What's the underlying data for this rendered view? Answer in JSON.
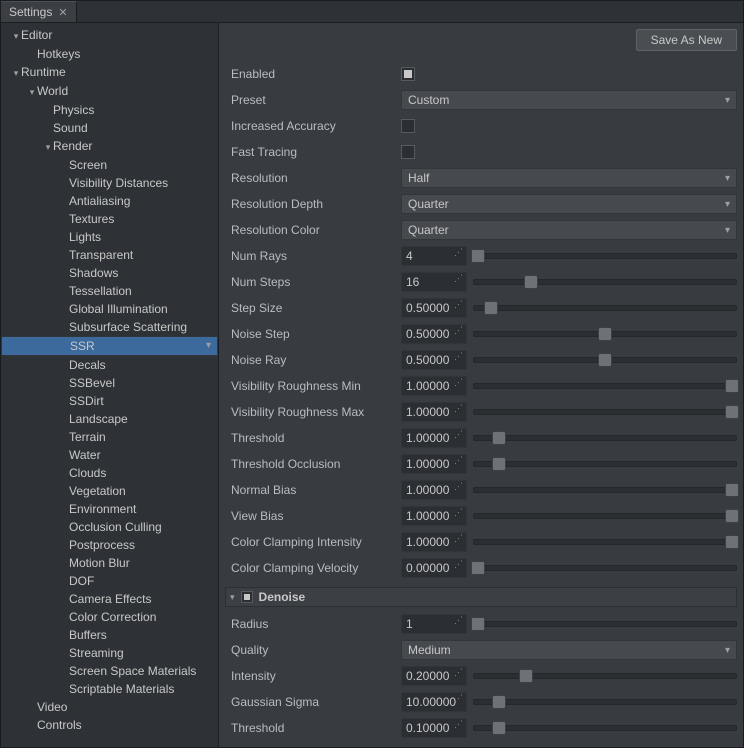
{
  "tab": {
    "title": "Settings"
  },
  "toolbar": {
    "save_as_new": "Save As New"
  },
  "tree": {
    "items": [
      {
        "label": "Editor",
        "level": 0,
        "expand": "down"
      },
      {
        "label": "Hotkeys",
        "level": 1,
        "expand": ""
      },
      {
        "label": "Runtime",
        "level": 0,
        "expand": "down"
      },
      {
        "label": "World",
        "level": 1,
        "expand": "down"
      },
      {
        "label": "Physics",
        "level": 2,
        "expand": ""
      },
      {
        "label": "Sound",
        "level": 2,
        "expand": ""
      },
      {
        "label": "Render",
        "level": 2,
        "expand": "down"
      },
      {
        "label": "Screen",
        "level": 3,
        "expand": ""
      },
      {
        "label": "Visibility Distances",
        "level": 3,
        "expand": ""
      },
      {
        "label": "Antialiasing",
        "level": 3,
        "expand": ""
      },
      {
        "label": "Textures",
        "level": 3,
        "expand": ""
      },
      {
        "label": "Lights",
        "level": 3,
        "expand": ""
      },
      {
        "label": "Transparent",
        "level": 3,
        "expand": ""
      },
      {
        "label": "Shadows",
        "level": 3,
        "expand": ""
      },
      {
        "label": "Tessellation",
        "level": 3,
        "expand": ""
      },
      {
        "label": "Global Illumination",
        "level": 3,
        "expand": ""
      },
      {
        "label": "Subsurface Scattering",
        "level": 3,
        "expand": ""
      },
      {
        "label": "SSR",
        "level": 3,
        "expand": "",
        "selected": true
      },
      {
        "label": "Decals",
        "level": 3,
        "expand": ""
      },
      {
        "label": "SSBevel",
        "level": 3,
        "expand": ""
      },
      {
        "label": "SSDirt",
        "level": 3,
        "expand": ""
      },
      {
        "label": "Landscape",
        "level": 3,
        "expand": ""
      },
      {
        "label": "Terrain",
        "level": 3,
        "expand": ""
      },
      {
        "label": "Water",
        "level": 3,
        "expand": ""
      },
      {
        "label": "Clouds",
        "level": 3,
        "expand": ""
      },
      {
        "label": "Vegetation",
        "level": 3,
        "expand": ""
      },
      {
        "label": "Environment",
        "level": 3,
        "expand": ""
      },
      {
        "label": "Occlusion Culling",
        "level": 3,
        "expand": ""
      },
      {
        "label": "Postprocess",
        "level": 3,
        "expand": ""
      },
      {
        "label": "Motion Blur",
        "level": 3,
        "expand": ""
      },
      {
        "label": "DOF",
        "level": 3,
        "expand": ""
      },
      {
        "label": "Camera Effects",
        "level": 3,
        "expand": ""
      },
      {
        "label": "Color Correction",
        "level": 3,
        "expand": ""
      },
      {
        "label": "Buffers",
        "level": 3,
        "expand": ""
      },
      {
        "label": "Streaming",
        "level": 3,
        "expand": ""
      },
      {
        "label": "Screen Space Materials",
        "level": 3,
        "expand": ""
      },
      {
        "label": "Scriptable Materials",
        "level": 3,
        "expand": ""
      },
      {
        "label": "Video",
        "level": 1,
        "expand": ""
      },
      {
        "label": "Controls",
        "level": 1,
        "expand": ""
      }
    ]
  },
  "props": [
    {
      "type": "check",
      "label": "Enabled",
      "value": true
    },
    {
      "type": "select",
      "label": "Preset",
      "value": "Custom"
    },
    {
      "type": "check",
      "label": "Increased Accuracy",
      "value": false
    },
    {
      "type": "check",
      "label": "Fast Tracing",
      "value": false
    },
    {
      "type": "select",
      "label": "Resolution",
      "value": "Half"
    },
    {
      "type": "select",
      "label": "Resolution Depth",
      "value": "Quarter"
    },
    {
      "type": "select",
      "label": "Resolution Color",
      "value": "Quarter"
    },
    {
      "type": "slider",
      "label": "Num Rays",
      "value": "4",
      "pos": 2
    },
    {
      "type": "slider",
      "label": "Num Steps",
      "value": "16",
      "pos": 22
    },
    {
      "type": "slider",
      "label": "Step Size",
      "value": "0.50000",
      "pos": 7
    },
    {
      "type": "slider",
      "label": "Noise Step",
      "value": "0.50000",
      "pos": 50
    },
    {
      "type": "slider",
      "label": "Noise Ray",
      "value": "0.50000",
      "pos": 50
    },
    {
      "type": "slider",
      "label": "Visibility Roughness Min",
      "value": "1.00000",
      "pos": 98
    },
    {
      "type": "slider",
      "label": "Visibility Roughness Max",
      "value": "1.00000",
      "pos": 98
    },
    {
      "type": "slider",
      "label": "Threshold",
      "value": "1.00000",
      "pos": 10
    },
    {
      "type": "slider",
      "label": "Threshold Occlusion",
      "value": "1.00000",
      "pos": 10
    },
    {
      "type": "slider",
      "label": "Normal Bias",
      "value": "1.00000",
      "pos": 98
    },
    {
      "type": "slider",
      "label": "View Bias",
      "value": "1.00000",
      "pos": 98
    },
    {
      "type": "slider",
      "label": "Color Clamping Intensity",
      "value": "1.00000",
      "pos": 98
    },
    {
      "type": "slider",
      "label": "Color Clamping Velocity",
      "value": "0.00000",
      "pos": 2
    }
  ],
  "section": {
    "title": "Denoise",
    "checked": true
  },
  "denoise": [
    {
      "type": "slider",
      "label": "Radius",
      "value": "1",
      "pos": 2
    },
    {
      "type": "select",
      "label": "Quality",
      "value": "Medium"
    },
    {
      "type": "slider",
      "label": "Intensity",
      "value": "0.20000",
      "pos": 20
    },
    {
      "type": "slider",
      "label": "Gaussian Sigma",
      "value": "10.00000",
      "pos": 10
    },
    {
      "type": "slider",
      "label": "Threshold",
      "value": "0.10000",
      "pos": 10
    }
  ]
}
